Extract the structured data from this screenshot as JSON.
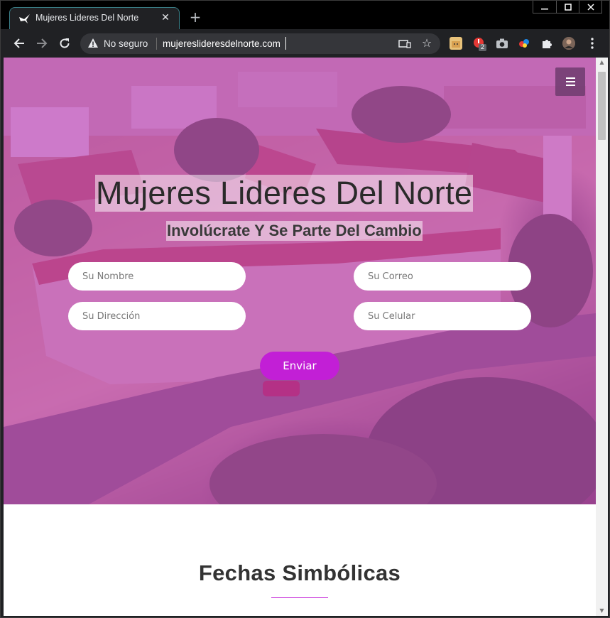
{
  "browser": {
    "tab_title": "Mujeres Lideres Del Norte",
    "security_label": "No seguro",
    "url": "mujereslideresdelnorte.com",
    "extension_badge": "2"
  },
  "hero": {
    "title": "Mujeres Lideres Del Norte",
    "subtitle": "Involúcrate Y Se Parte Del Cambio",
    "overlay_color": "#be3cbe"
  },
  "form": {
    "name_placeholder": "Su Nombre",
    "email_placeholder": "Su Correo",
    "address_placeholder": "Su Dirección",
    "phone_placeholder": "Su Celular",
    "submit_label": "Enviar",
    "accent_color": "#c21fd6"
  },
  "sections": {
    "dates_title": "Fechas Simbólicas"
  }
}
